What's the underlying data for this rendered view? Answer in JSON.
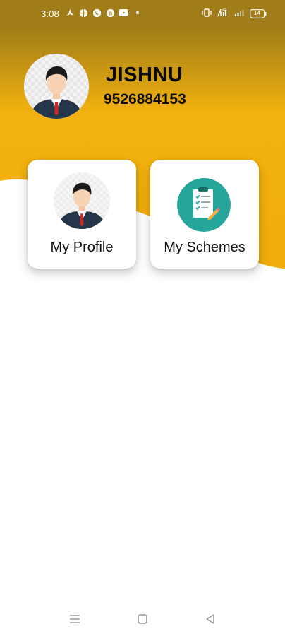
{
  "status_bar": {
    "time": "3:08",
    "battery": "14",
    "left_icons": [
      "fan-icon",
      "ball-icon",
      "whatsapp-icon",
      "whatsapp-business-icon",
      "youtube-icon"
    ],
    "right_icons": [
      "vibrate-icon",
      "volte-icon",
      "signal-icon",
      "battery-icon"
    ]
  },
  "profile": {
    "name": "JISHNU",
    "phone": "9526884153",
    "avatar_icon": "person-avatar-icon"
  },
  "cards": [
    {
      "label": "My Profile",
      "icon": "profile-avatar-icon"
    },
    {
      "label": "My Schemes",
      "icon": "checklist-icon"
    }
  ],
  "colors": {
    "header_gold": "#f2b20f",
    "header_dark": "#a07d18",
    "schemes_icon_bg": "#26a69a"
  },
  "nav_bar": {
    "buttons": [
      "menu-icon",
      "home-icon",
      "back-icon"
    ]
  }
}
